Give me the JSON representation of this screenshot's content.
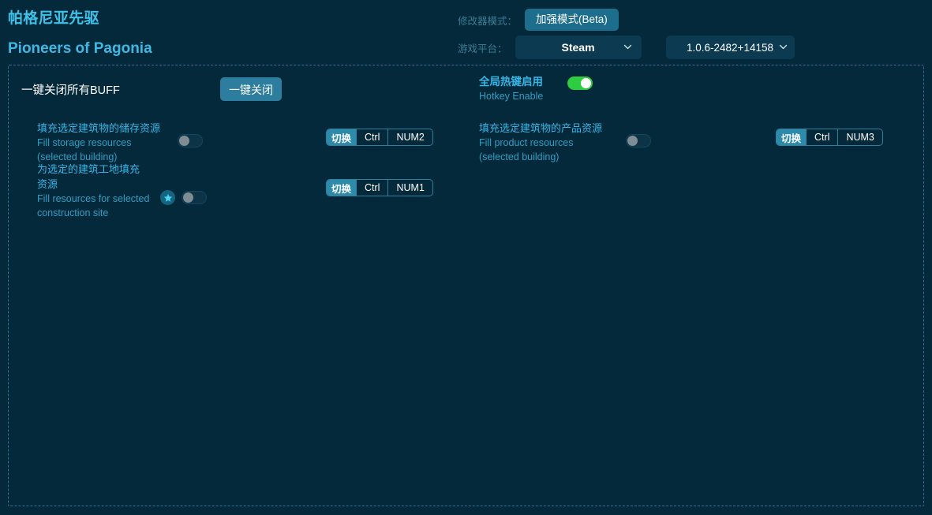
{
  "window": {
    "background": "#04293a",
    "panel_border": "#2f7391"
  },
  "header": {
    "title_cn": "帕格尼亚先驱",
    "title_en": "Pioneers of Pagonia",
    "mode_label": "修改器模式：",
    "mode_button": "加强模式(Beta)",
    "platform_label": "游戏平台：",
    "platform_value": "Steam",
    "version_value": "1.0.6-2482+14158",
    "accent": "#1d6d8c"
  },
  "panel": {
    "onekey": {
      "label": "一键关闭所有BUFF",
      "button": "一键关闭"
    },
    "hotkey_enable": {
      "cn": "全局热键启用",
      "en": "Hotkey Enable",
      "state": "on",
      "on_color": "#2ecc40"
    },
    "cheats": [
      {
        "cn": "填充选定建筑物的储存资源",
        "en_line1": "Fill storage resources",
        "en_line2": "(selected building)",
        "toggle": "off",
        "starred": false,
        "hotkey": {
          "action": "切换",
          "modifier": "Ctrl",
          "key": "NUM2"
        }
      },
      {
        "cn_line1": "为选定的建筑工地填充",
        "cn_line2": "资源",
        "en_line1": "Fill resources for selected",
        "en_line2": "construction site",
        "toggle": "off",
        "starred": true,
        "hotkey": {
          "action": "切换",
          "modifier": "Ctrl",
          "key": "NUM1"
        }
      },
      {
        "cn": "填充选定建筑物的产品资源",
        "en_line1": "Fill product resources",
        "en_line2": "(selected building)",
        "toggle": "off",
        "starred": false,
        "hotkey": {
          "action": "切换",
          "modifier": "Ctrl",
          "key": "NUM3"
        }
      }
    ]
  }
}
